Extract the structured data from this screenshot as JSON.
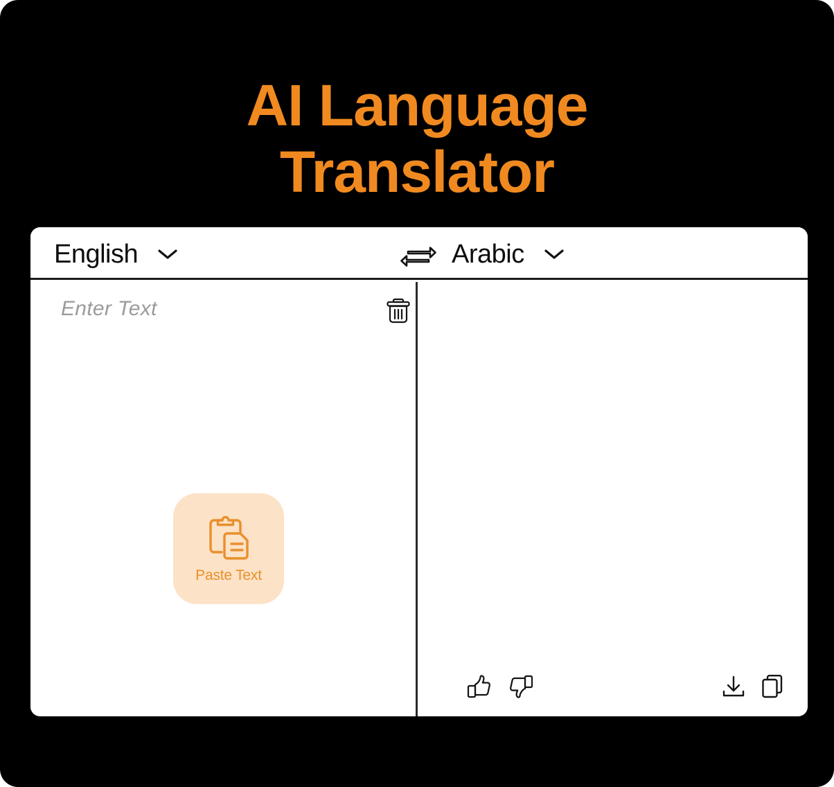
{
  "app": {
    "title": "AI Language\nTranslator",
    "accent_color": "#F08A20",
    "paste_button_bg": "#FCE2C6",
    "background_color": "#000000",
    "card_background": "#FFFFFF"
  },
  "header": {
    "source_language": "English",
    "target_language": "Arabic",
    "source_chevron_icon": "chevron-down-icon",
    "target_chevron_icon": "chevron-down-icon",
    "swap_icon": "swap-horizontal-icon"
  },
  "source_pane": {
    "placeholder": "Enter Text",
    "value": "",
    "clear_icon": "trash-icon",
    "paste_button": {
      "label": "Paste Text",
      "icon": "clipboard-document-icon"
    }
  },
  "target_pane": {
    "value": "",
    "actions": [
      {
        "name": "thumbs-up-icon",
        "label": "Good translation"
      },
      {
        "name": "thumbs-down-icon",
        "label": "Bad translation"
      },
      {
        "name": "download-icon",
        "label": "Download"
      },
      {
        "name": "copy-icon",
        "label": "Copy"
      }
    ]
  }
}
